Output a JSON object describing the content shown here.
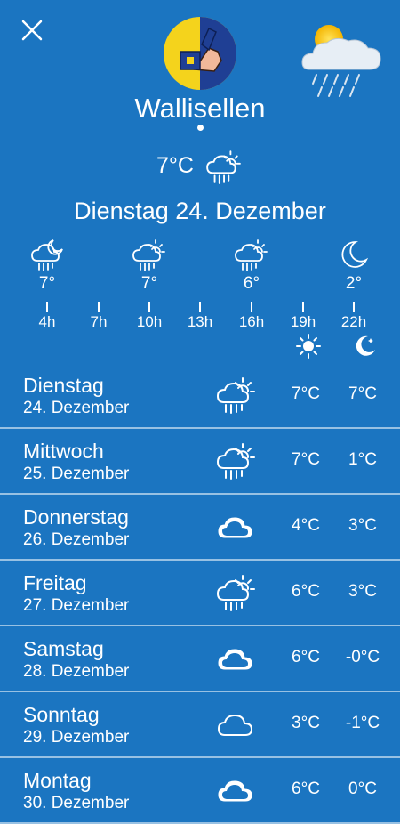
{
  "header": {
    "close_icon": "close-icon",
    "crest_icon": "coat-of-arms-icon",
    "hero_icon": "sun-cloud-rain-icon"
  },
  "location": {
    "city": "Wallisellen"
  },
  "current": {
    "temp": "7°C",
    "icon": "rain-sun-icon",
    "date": "Dienstag 24. Dezember"
  },
  "hourly": [
    {
      "icon": "rain-moon-icon",
      "temp": "7°",
      "time": "4h"
    },
    {
      "time": "7h"
    },
    {
      "icon": "rain-sun-icon",
      "temp": "7°",
      "time": "10h"
    },
    {
      "time": "13h"
    },
    {
      "icon": "rain-sun-icon",
      "temp": "6°",
      "time": "16h"
    },
    {
      "time": "19h"
    },
    {
      "icon": "moon-icon",
      "temp": "2°",
      "time": "22h"
    }
  ],
  "legend": {
    "day_icon": "sun-icon",
    "night_icon": "moon-icon"
  },
  "days": [
    {
      "name": "Dienstag",
      "date": "24. Dezember",
      "icon": "rain-sun",
      "high": "7°C",
      "low": "7°C"
    },
    {
      "name": "Mittwoch",
      "date": "25. Dezember",
      "icon": "rain-sun",
      "high": "7°C",
      "low": "1°C"
    },
    {
      "name": "Donnerstag",
      "date": "26. Dezember",
      "icon": "cloud",
      "high": "4°C",
      "low": "3°C"
    },
    {
      "name": "Freitag",
      "date": "27. Dezember",
      "icon": "rain-sun",
      "high": "6°C",
      "low": "3°C"
    },
    {
      "name": "Samstag",
      "date": "28. Dezember",
      "icon": "cloud",
      "high": "6°C",
      "low": "-0°C"
    },
    {
      "name": "Sonntag",
      "date": "29. Dezember",
      "icon": "cloud-outline",
      "high": "3°C",
      "low": "-1°C"
    },
    {
      "name": "Montag",
      "date": "30. Dezember",
      "icon": "cloud",
      "high": "6°C",
      "low": "0°C"
    }
  ]
}
